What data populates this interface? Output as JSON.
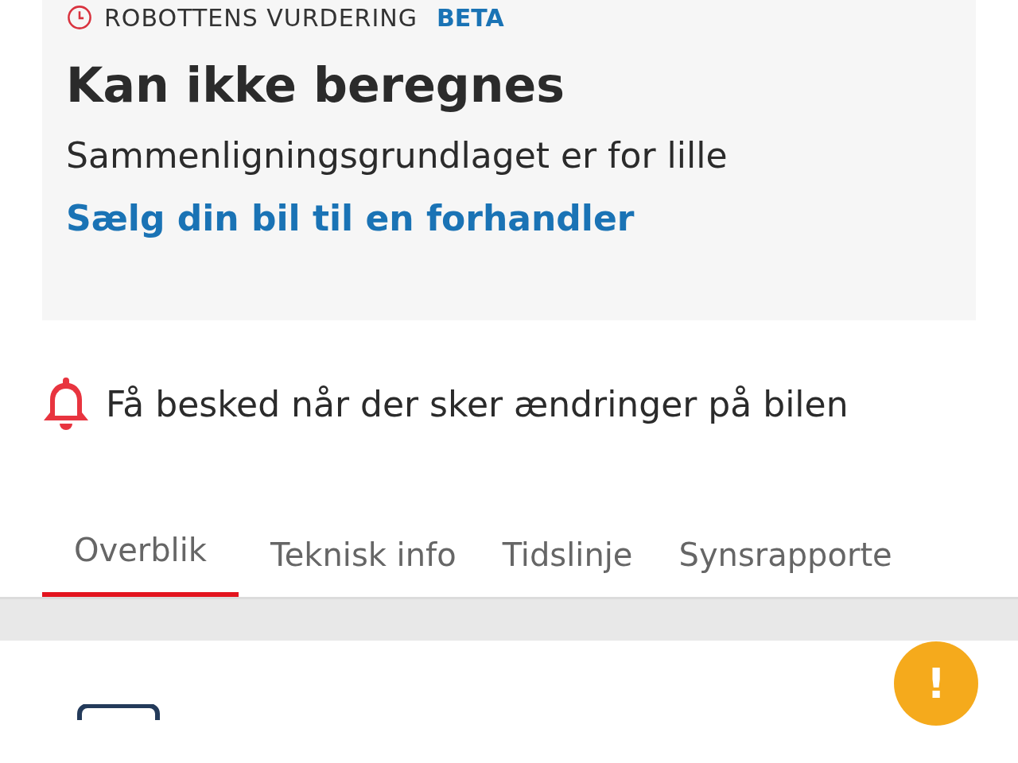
{
  "valuation": {
    "label": "ROBOTTENS VURDERING",
    "badge": "BETA",
    "title": "Kan ikke beregnes",
    "message": "Sammenligningsgrundlaget er for lille",
    "link": "Sælg din bil til en forhandler"
  },
  "notify": {
    "text": "Få besked når der sker ændringer på bilen"
  },
  "tabs": [
    {
      "label": "Overblik",
      "selected": true
    },
    {
      "label": "Teknisk info",
      "selected": false
    },
    {
      "label": "Tidslinje",
      "selected": false
    },
    {
      "label": "Synsrapporte",
      "selected": false
    }
  ],
  "fab": {
    "label": "!"
  }
}
